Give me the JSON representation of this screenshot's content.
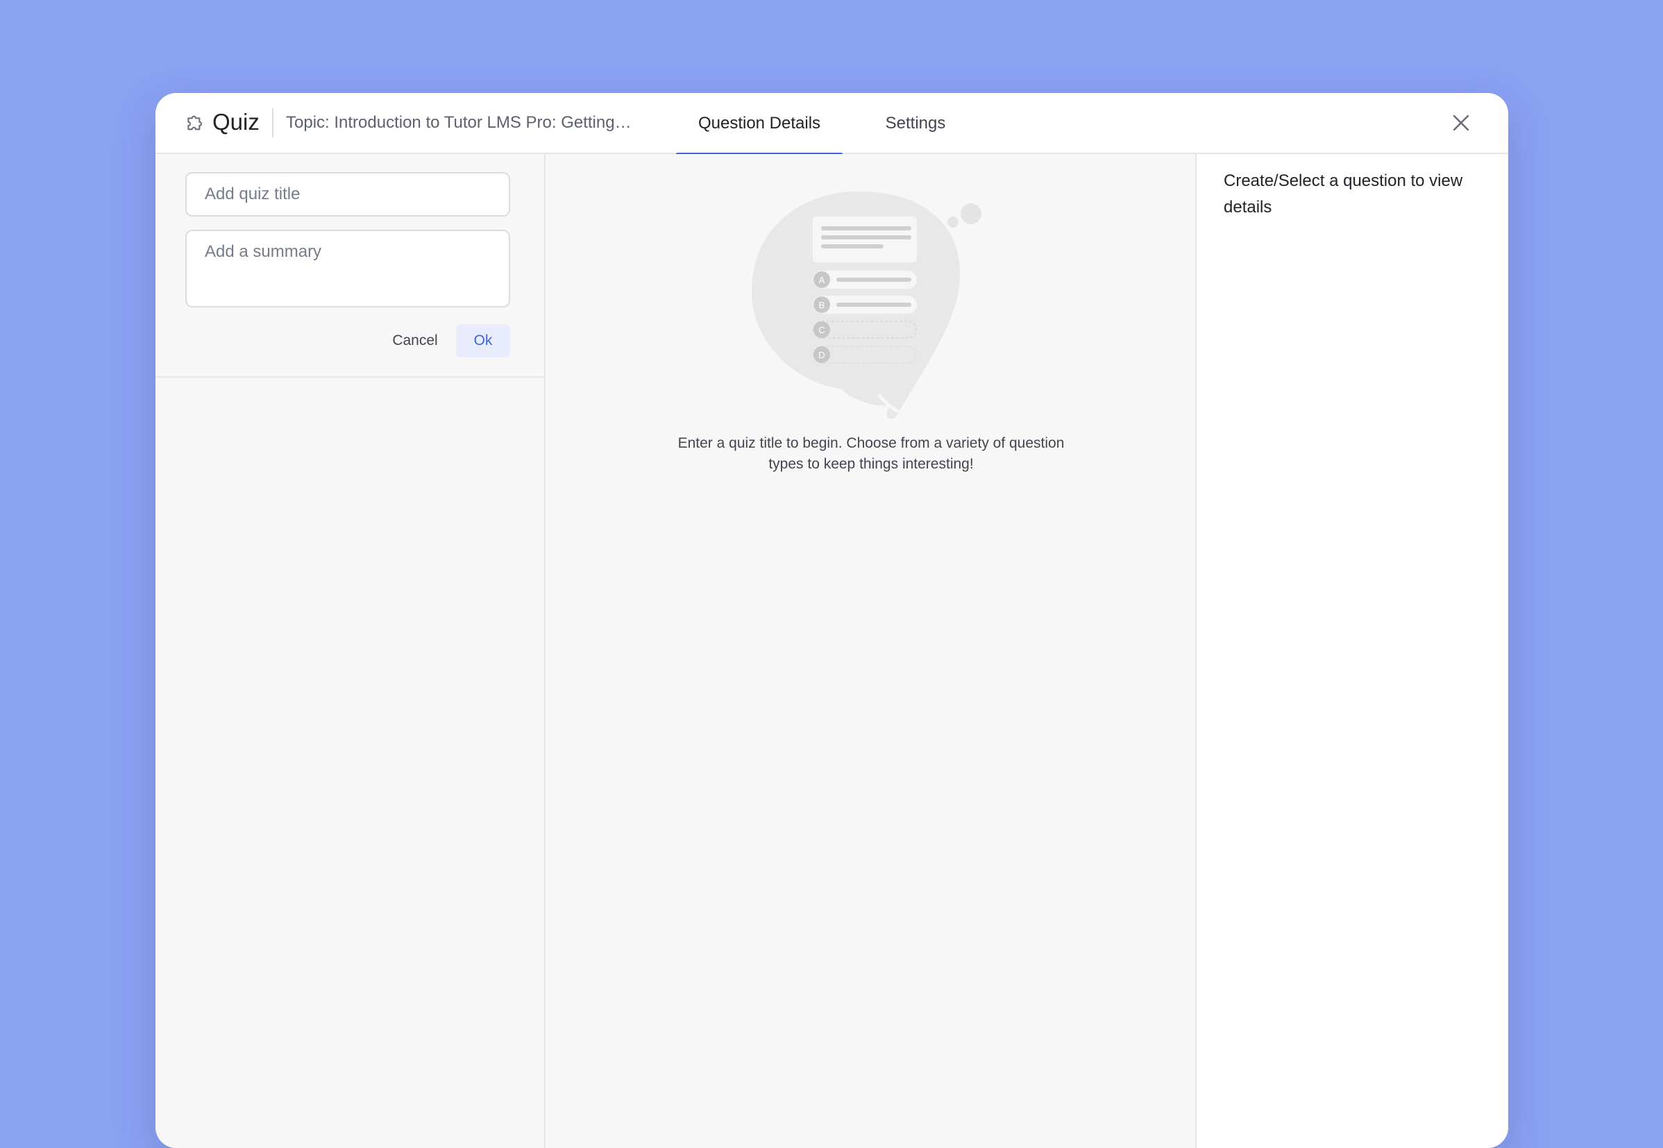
{
  "header": {
    "title": "Quiz",
    "topic": "Topic: Introduction to Tutor LMS Pro: Getting…",
    "tabs": [
      {
        "label": "Question Details",
        "active": true
      },
      {
        "label": "Settings",
        "active": false
      }
    ],
    "close_icon": "close-icon",
    "quiz_icon": "puzzle-icon"
  },
  "form": {
    "title_placeholder": "Add quiz title",
    "title_value": "",
    "summary_placeholder": "Add a summary",
    "summary_value": "",
    "cancel_label": "Cancel",
    "ok_label": "Ok"
  },
  "center": {
    "illustration_icon": "quiz-bubble-illustration",
    "option_letters": [
      "A",
      "B",
      "C",
      "D"
    ],
    "empty_message": "Enter a quiz title to begin. Choose from a variety of question types to keep things interesting!"
  },
  "right": {
    "message": "Create/Select a question to view details"
  },
  "colors": {
    "background": "#8ba1f2",
    "accent": "#3e64de",
    "panel": "#f7f7f7",
    "ok_bg": "#e8ecfc"
  }
}
